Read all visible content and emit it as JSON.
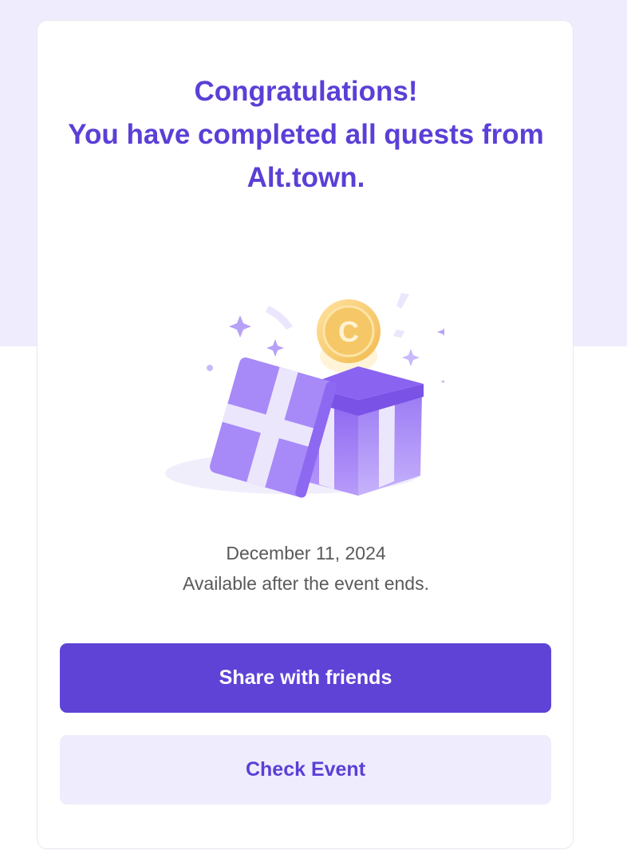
{
  "congrats": {
    "line1": "Congratulations!",
    "line2": "You have completed all quests from",
    "line3": "Alt.town."
  },
  "illustration": {
    "coin_letter": "C",
    "icon": "gift-box-with-coin"
  },
  "info": {
    "date": "December 11, 2024",
    "availability": "Available after the event ends."
  },
  "actions": {
    "share_label": "Share with friends",
    "check_label": "Check Event"
  },
  "colors": {
    "accent": "#5f43d6",
    "accent_text": "#5b3fd6",
    "light_bg": "#efecfd"
  }
}
